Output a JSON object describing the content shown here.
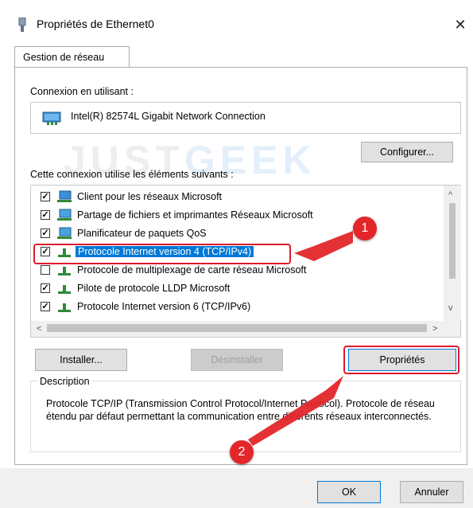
{
  "window": {
    "title": "Propriétés de Ethernet0",
    "close_glyph": "✕"
  },
  "tabs": [
    {
      "label": "Gestion de réseau"
    }
  ],
  "connection": {
    "label": "Connexion en utilisant :",
    "adapter_name": "Intel(R) 82574L Gigabit Network Connection",
    "adapter_icon": "network-adapter-icon",
    "configure_label": "Configurer..."
  },
  "watermark": {
    "part1": "JUST",
    "part2": "GEEK"
  },
  "items_label": "Cette connexion utilise les éléments suivants :",
  "items": [
    {
      "label": "Client pour les réseaux Microsoft",
      "checked": true,
      "icon": "network-client-icon"
    },
    {
      "label": "Partage de fichiers et imprimantes Réseaux Microsoft",
      "checked": true,
      "icon": "network-service-icon"
    },
    {
      "label": "Planificateur de paquets QoS",
      "checked": true,
      "icon": "network-service-icon"
    },
    {
      "label": "Protocole Internet version 4 (TCP/IPv4)",
      "checked": true,
      "icon": "protocol-icon",
      "selected": true
    },
    {
      "label": "Protocole de multiplexage de carte réseau Microsoft",
      "checked": false,
      "icon": "protocol-icon"
    },
    {
      "label": "Pilote de protocole LLDP Microsoft",
      "checked": true,
      "icon": "protocol-icon"
    },
    {
      "label": "Protocole Internet version 6 (TCP/IPv6)",
      "checked": true,
      "icon": "protocol-icon"
    }
  ],
  "scroll": {
    "up": "^",
    "down": "v",
    "left": "<",
    "right": ">"
  },
  "buttons": {
    "install": "Installer...",
    "uninstall": "Désinstaller",
    "properties": "Propriétés",
    "ok": "OK",
    "cancel": "Annuler"
  },
  "description": {
    "legend": "Description",
    "text": "Protocole TCP/IP (Transmission Control Protocol/Internet Protocol). Protocole de réseau étendu par défaut permettant la communication entre différents réseaux interconnectés."
  },
  "annotations": {
    "badge1": "1",
    "badge2": "2",
    "color": "#e3262a"
  },
  "colors": {
    "selection": "#0078d7",
    "accent_border": "#0078d7",
    "annotation": "#e3262a"
  }
}
